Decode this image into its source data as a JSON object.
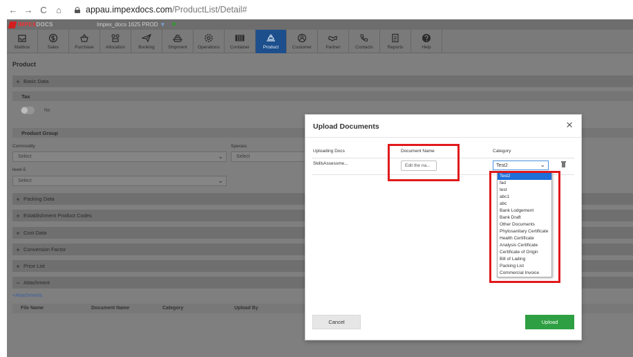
{
  "browser": {
    "back": "←",
    "forward": "→",
    "reload": "C",
    "home": "⌂",
    "url_host": "appau.impexdocs.com",
    "url_path": "/ProductList/Detail#"
  },
  "app": {
    "logo_text_a": "IMPEX",
    "logo_text_b": "DOCS",
    "tenant": "Impex_docs 1625 PROD",
    "menu": [
      {
        "label": "Mailbox",
        "icon": "mailbox-icon"
      },
      {
        "label": "Sales",
        "icon": "dollar-icon"
      },
      {
        "label": "Purchase",
        "icon": "basket-icon"
      },
      {
        "label": "Allocation",
        "icon": "allocation-icon"
      },
      {
        "label": "Booking",
        "icon": "paper-plane-icon"
      },
      {
        "label": "Shipment",
        "icon": "ship-icon"
      },
      {
        "label": "Operations",
        "icon": "gear-icon"
      },
      {
        "label": "Container",
        "icon": "container-icon"
      },
      {
        "label": "Product",
        "icon": "product-icon"
      },
      {
        "label": "Customer",
        "icon": "customer-icon"
      },
      {
        "label": "Partner",
        "icon": "handshake-icon"
      },
      {
        "label": "Contacts",
        "icon": "phone-icon"
      },
      {
        "label": "Reports",
        "icon": "report-icon"
      },
      {
        "label": "Help",
        "icon": "help-icon"
      }
    ],
    "active_menu": "Product"
  },
  "product": {
    "title": "Product",
    "basic_data": "Basic Data",
    "tax": "Tax",
    "tax_toggle": "No",
    "product_group": "Product Group",
    "commodity_label": "Commodity",
    "commodity_value": "Select",
    "species_label": "Species",
    "species_value": "Select",
    "level5_label": "level-5",
    "level5_value": "Select",
    "packing_data": "Packing Data",
    "establishment": "Establishment Product Codes",
    "cost_data": "Cost Data",
    "conversion": "Conversion Factor",
    "price_list": "Price List",
    "attachment": "Attachment",
    "add_attachments": "+Attachments",
    "att_cols": [
      "File Name",
      "Document Name",
      "Category",
      "Upload By"
    ]
  },
  "modal": {
    "title": "Upload Documents",
    "close": "×",
    "col_uploading": "Uploading Docs",
    "col_docname": "Document Name",
    "col_category": "Category",
    "file": "SkillsAssessme...",
    "docname_placeholder": "Edit the na...",
    "category_value": "Test2",
    "category_options": [
      "Test2",
      "fad",
      "test",
      "abc1",
      "abc",
      "Bank Lodgement",
      "Bank Draft",
      "Other Documents",
      "Phytosanitary Certificate",
      "Health Certificate",
      "Analysis Certificate",
      "Certificate of Origin",
      "Bill of Lading",
      "Packing List",
      "Commercial Invoice"
    ],
    "cancel": "Cancel",
    "upload": "Upload"
  },
  "colors": {
    "highlight": "#e0191b",
    "upload_button": "#2ea043",
    "active_menu": "#1d4f8c"
  }
}
